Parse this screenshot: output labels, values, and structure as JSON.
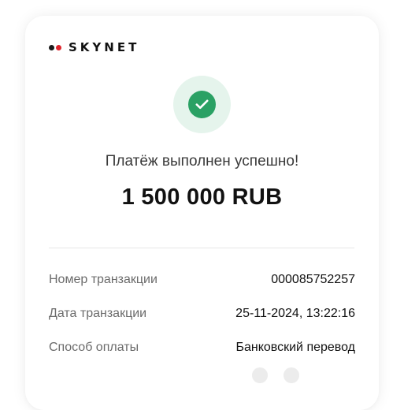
{
  "brand": {
    "name": "SKYNET",
    "dot_colors": [
      "#1a1a1a",
      "#e0242c"
    ]
  },
  "status": {
    "icon": "check-icon",
    "outer_color": "#e5f4ec",
    "inner_color": "#2aa164",
    "message": "Платёж выполнен успешно!"
  },
  "payment": {
    "amount": "1 500 000 RUB"
  },
  "details": [
    {
      "label": "Номер транзакции",
      "value": "000085752257"
    },
    {
      "label": "Дата транзакции",
      "value": "25-11-2024, 13:22:16"
    },
    {
      "label": "Способ оплаты",
      "value": "Банковский перевод"
    }
  ]
}
